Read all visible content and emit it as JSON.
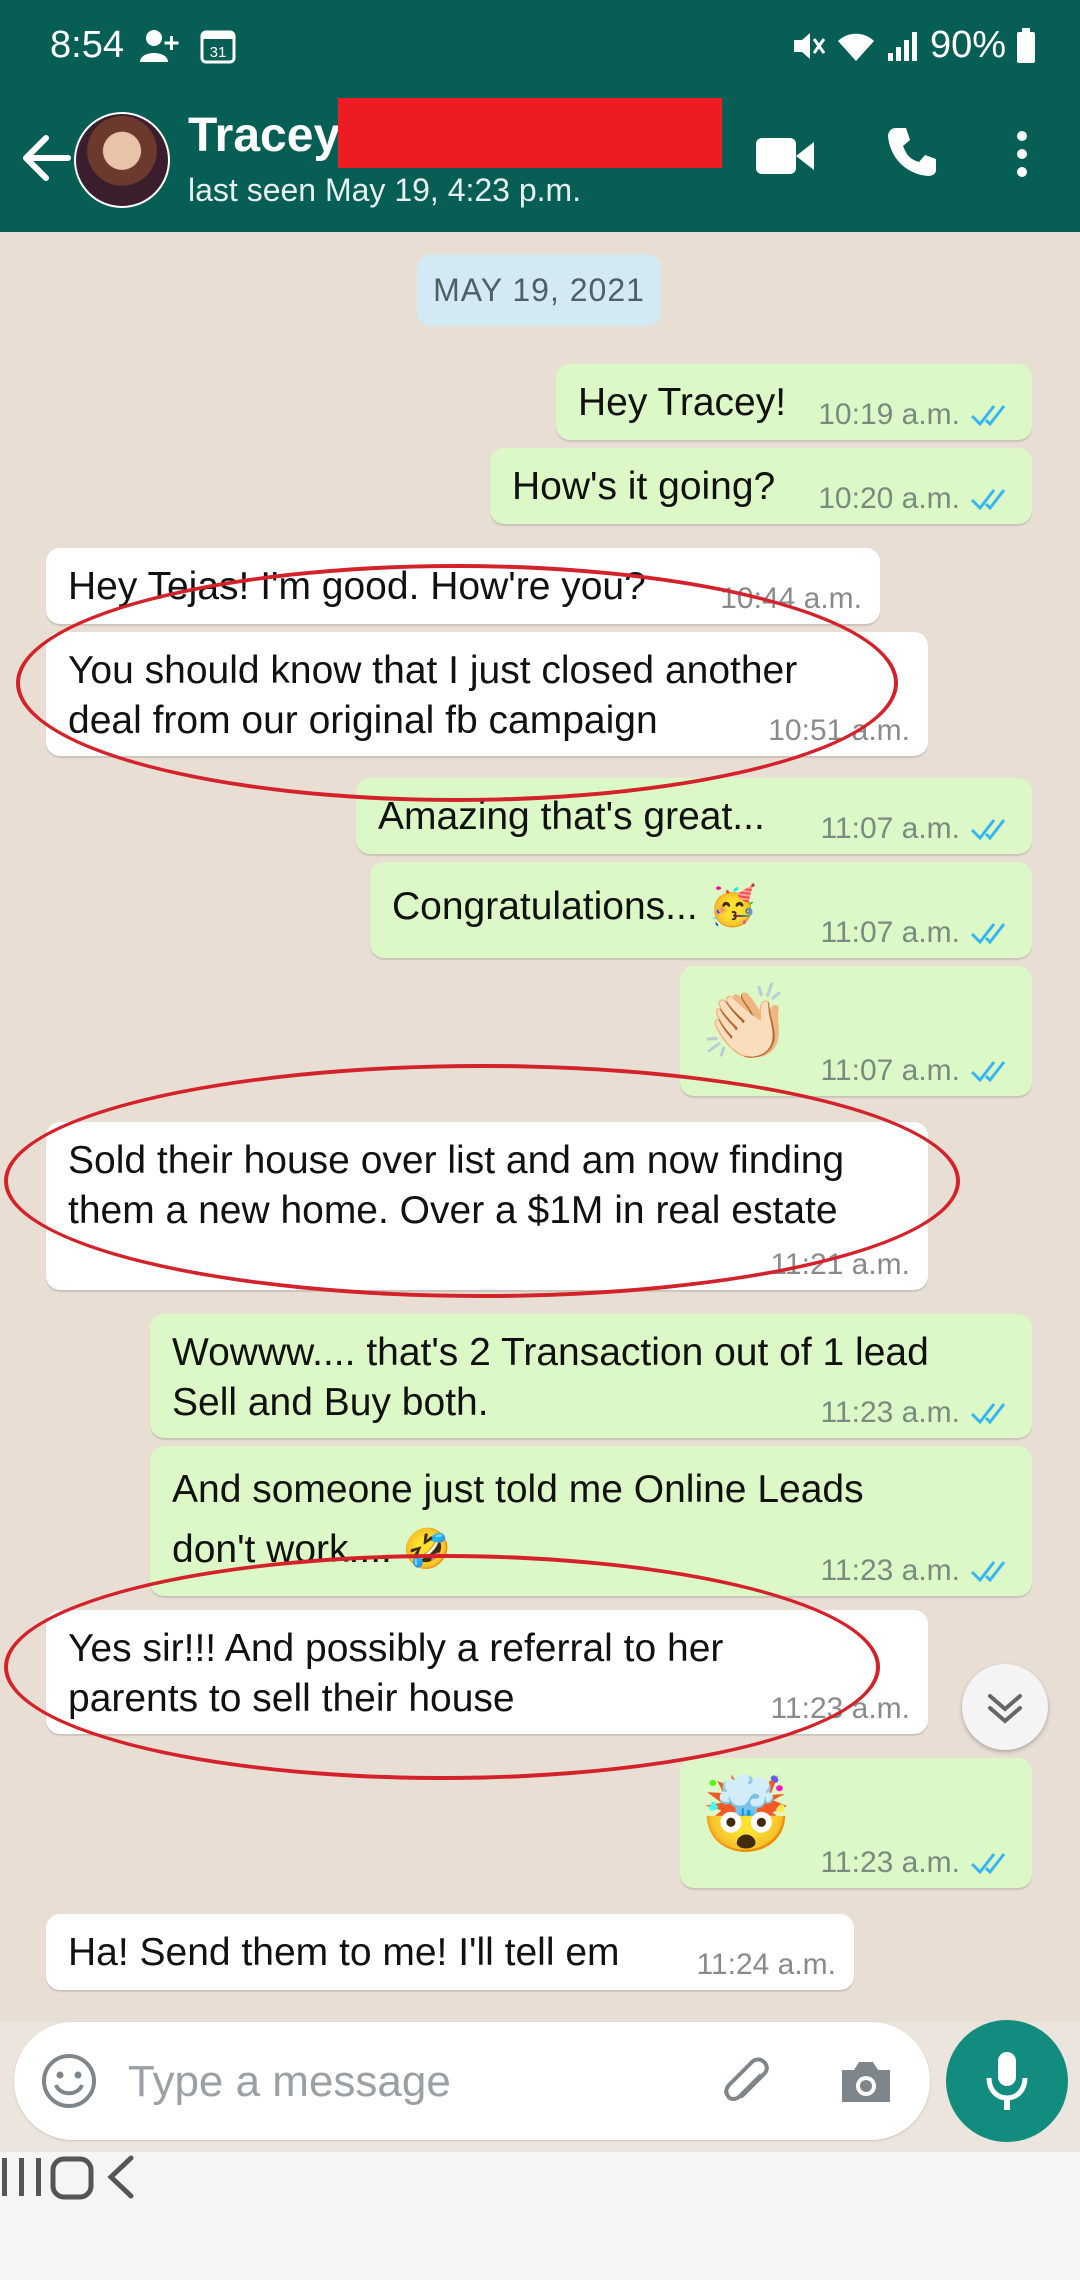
{
  "status": {
    "time": "8:54",
    "battery": "90%"
  },
  "header": {
    "contact_name": "Tracey",
    "last_seen": "last seen May 19, 4:23 p.m."
  },
  "chat": {
    "date_chip": "MAY 19, 2021",
    "messages": [
      {
        "dir": "out",
        "lines": [
          "Hey Tracey!"
        ],
        "time": "10:19 a.m."
      },
      {
        "dir": "out",
        "lines": [
          "How's it going?"
        ],
        "time": "10:20 a.m."
      },
      {
        "dir": "in",
        "lines": [
          "Hey Tejas! I'm good. How're you?"
        ],
        "time": "10:44 a.m."
      },
      {
        "dir": "in",
        "lines": [
          "You should know that I just closed another",
          "deal from our original fb campaign"
        ],
        "time": "10:51 a.m."
      },
      {
        "dir": "out",
        "lines": [
          "Amazing that's great..."
        ],
        "time": "11:07 a.m."
      },
      {
        "dir": "out",
        "lines": [
          "Congratulations... 🥳"
        ],
        "time": "11:07 a.m."
      },
      {
        "dir": "out",
        "lines": [
          "👏🏻"
        ],
        "time": "11:07 a.m."
      },
      {
        "dir": "in",
        "lines": [
          "Sold their house over list and am now finding",
          "them a new home. Over a $1M in real estate"
        ],
        "time": "11:21 a.m."
      },
      {
        "dir": "out",
        "lines": [
          "Wowww.... that's 2 Transaction out of 1 lead",
          "Sell and Buy both."
        ],
        "time": "11:23 a.m."
      },
      {
        "dir": "out",
        "lines": [
          "And someone just told me Online Leads",
          "don't work.... 🤣"
        ],
        "time": "11:23 a.m."
      },
      {
        "dir": "in",
        "lines": [
          "Yes sir!!! And possibly a referral to her",
          "parents to sell their house"
        ],
        "time": "11:23 a.m."
      },
      {
        "dir": "out",
        "lines": [
          "🤯"
        ],
        "time": "11:23 a.m."
      },
      {
        "dir": "in",
        "lines": [
          "Ha! Send them to me! I'll tell em"
        ],
        "time": "11:24 a.m."
      }
    ]
  },
  "composer": {
    "placeholder": "Type a message"
  },
  "colors": {
    "header": "#075e54",
    "outgoing": "#dcf8c6",
    "incoming": "#ffffff",
    "read_ticks": "#34b7f1",
    "annotation": "#d3222a",
    "redaction": "#ed1c24",
    "mic": "#128c7e"
  },
  "icons": [
    "back-arrow-icon",
    "video-call-icon",
    "voice-call-icon",
    "more-options-icon",
    "emoji-icon",
    "attach-icon",
    "camera-icon",
    "mic-icon",
    "scroll-down-icon",
    "read-ticks-icon"
  ]
}
